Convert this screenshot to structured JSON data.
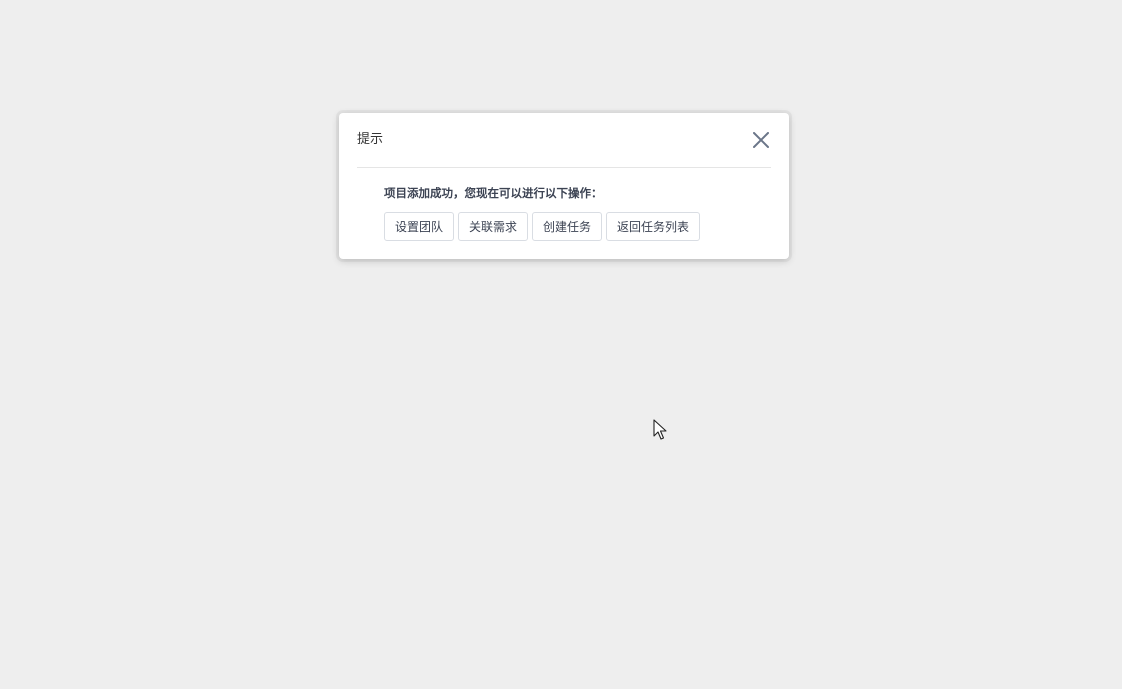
{
  "dialog": {
    "title": "提示",
    "message": "项目添加成功，您现在可以进行以下操作：",
    "actions": [
      {
        "label": "设置团队"
      },
      {
        "label": "关联需求"
      },
      {
        "label": "创建任务"
      },
      {
        "label": "返回任务列表"
      }
    ],
    "close_icon": "close-icon"
  },
  "colors": {
    "background": "#eeeeee",
    "dialog_bg": "#ffffff",
    "text": "#3c4353",
    "border": "#d9dde3",
    "close_icon": "#6b7689"
  },
  "cursor_icon": "mouse-pointer-icon"
}
